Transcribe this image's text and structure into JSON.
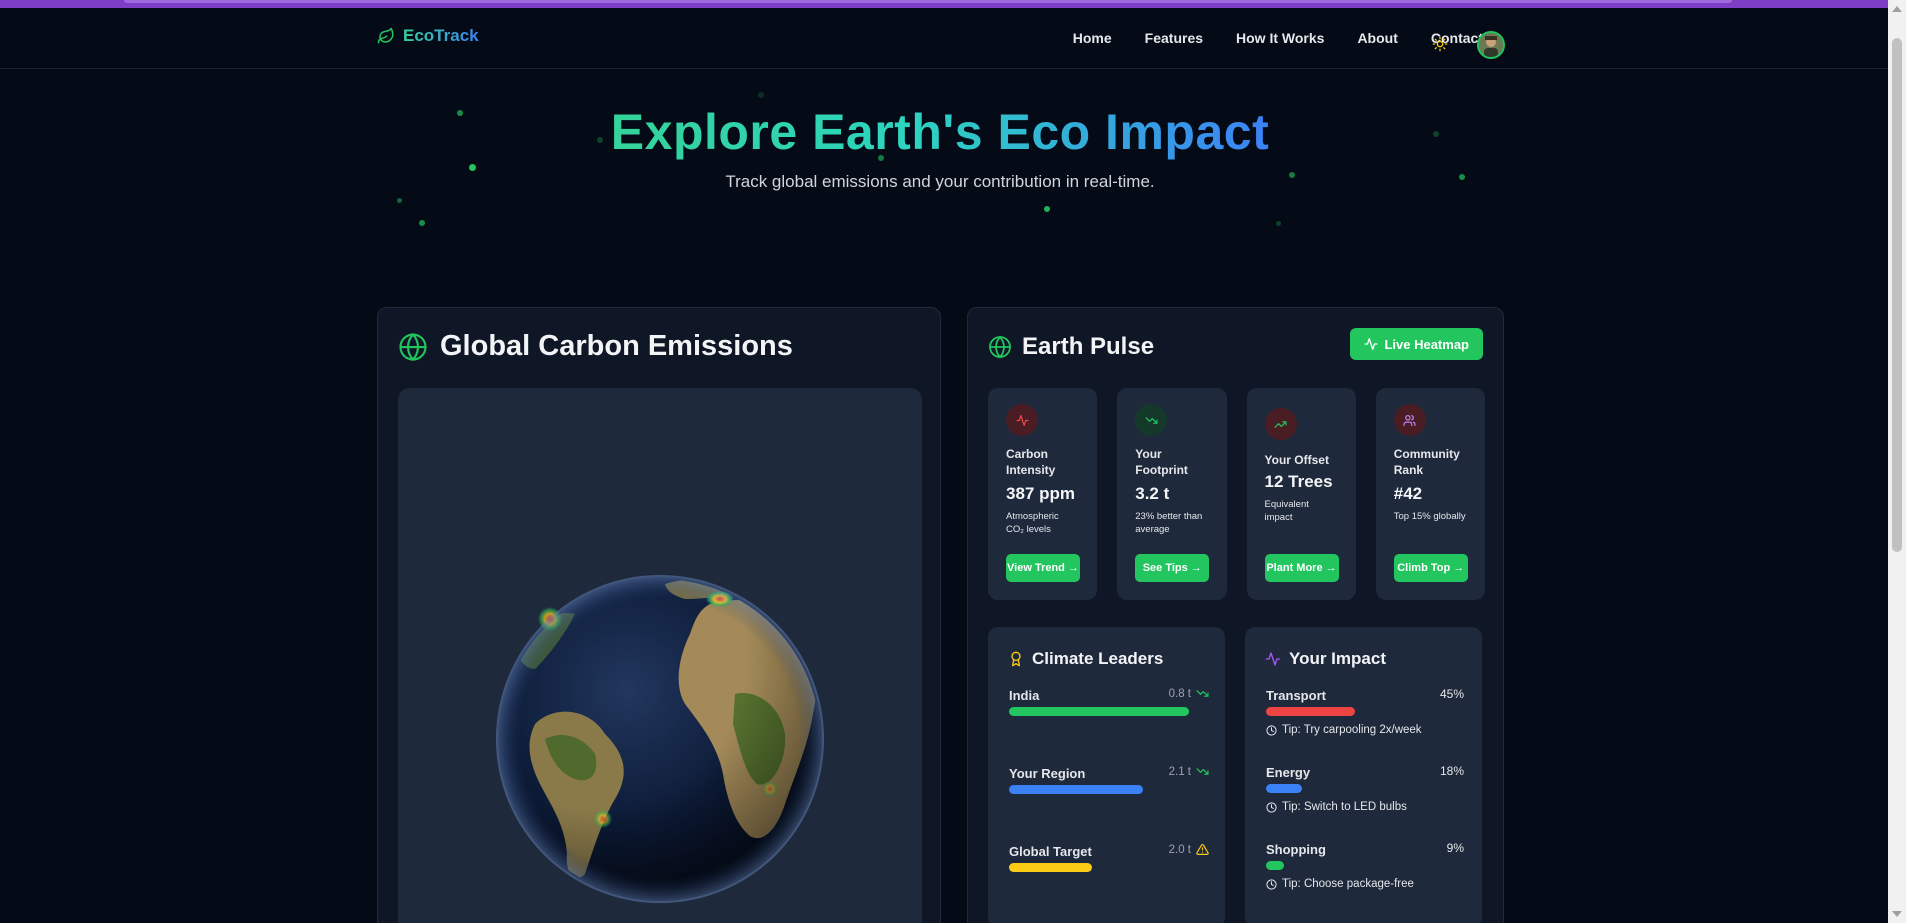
{
  "nav": {
    "brand": "EcoTrack",
    "links": [
      "Home",
      "Features",
      "How It Works",
      "About",
      "Contact"
    ]
  },
  "hero": {
    "title": "Explore Earth's Eco Impact",
    "subtitle": "Track global emissions and your contribution in real-time."
  },
  "left_card": {
    "title": "Global Carbon Emissions"
  },
  "right_card": {
    "title": "Earth Pulse",
    "live_button": "Live Heatmap",
    "stats": [
      {
        "label": "Carbon Intensity",
        "value": "387 ppm",
        "note": "Atmospheric CO₂ levels",
        "button": "View Trend →",
        "icon": "activity-icon",
        "icon_color": "#ef4444",
        "icon_bg": "#4a1d24"
      },
      {
        "label": "Your Footprint",
        "value": "3.2 t",
        "note": "23% better than average",
        "button": "See Tips →",
        "icon": "trending-down-icon",
        "icon_color": "#22c55e",
        "icon_bg": "#14392a"
      },
      {
        "label": "Your Offset",
        "value": "12 Trees",
        "note": "Equivalent impact",
        "button": "Plant More →",
        "icon": "trending-up-icon",
        "icon_color": "#22c55e",
        "icon_bg": "#4a1d24"
      },
      {
        "label": "Community Rank",
        "value": "#42",
        "note": "Top 15% globally",
        "button": "Climb Top →",
        "icon": "users-icon",
        "icon_color": "#c084fc",
        "icon_bg": "#4a1d24"
      }
    ]
  },
  "leaders": {
    "title": "Climate Leaders",
    "items": [
      {
        "name": "India",
        "value": "0.8 t",
        "fill": 1.0,
        "color": "#22c55e",
        "indicator": "trending-down-icon"
      },
      {
        "name": "Your Region",
        "value": "2.1 t",
        "fill": 0.74,
        "color": "#3b82f6",
        "indicator": "trending-down-icon"
      },
      {
        "name": "Global Target",
        "value": "2.0 t",
        "fill": 0.46,
        "color": "#facc15",
        "indicator": "warning-icon"
      }
    ]
  },
  "impact": {
    "title": "Your Impact",
    "items": [
      {
        "name": "Transport",
        "pct": "45%",
        "tip": "Tip: Try carpooling 2x/week",
        "color": "#ef4444",
        "fill": 0.45
      },
      {
        "name": "Energy",
        "pct": "18%",
        "tip": "Tip: Switch to LED bulbs",
        "color": "#3b82f6",
        "fill": 0.18
      },
      {
        "name": "Shopping",
        "pct": "9%",
        "tip": "Tip: Choose package-free",
        "color": "#22c55e",
        "fill": 0.09
      }
    ]
  },
  "colors": {
    "accent": "#22c55e",
    "background": "#050b16",
    "card": "#0f1726",
    "panel": "#1e293b"
  }
}
